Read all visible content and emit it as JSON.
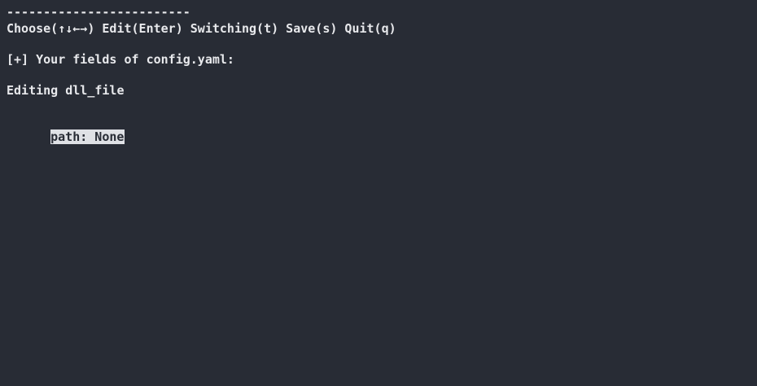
{
  "terminal": {
    "separator": "-------------------------",
    "help_line": "Choose(↑↓←→) Edit(Enter) Switching(t) Save(s) Quit(q)",
    "fields_header": "[+] Your fields of config.yaml:",
    "editing_label": "Editing dll_file",
    "selected_field": "path: None"
  },
  "colors": {
    "background": "#282c35",
    "foreground": "#e8e9ec",
    "highlight_bg": "#dfe1e5"
  }
}
